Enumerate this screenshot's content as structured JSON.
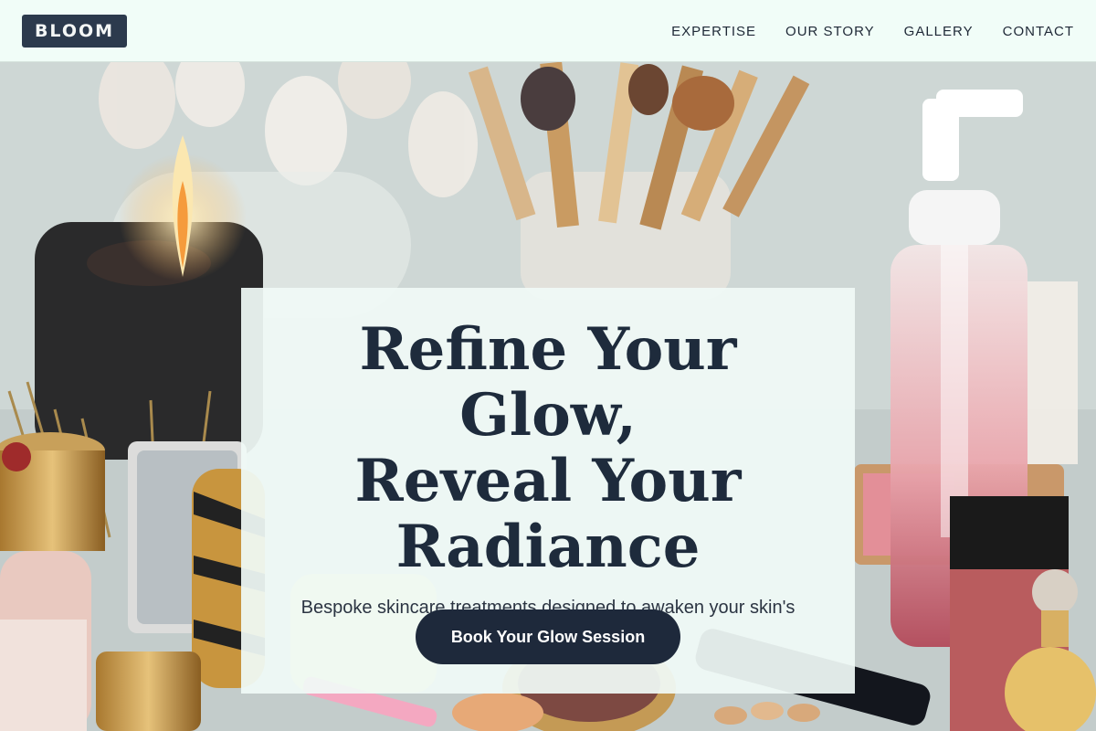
{
  "header": {
    "logo": "BLOOM",
    "nav": [
      "EXPERTISE",
      "OUR STORY",
      "GALLERY",
      "CONTACT"
    ]
  },
  "hero": {
    "headline_lines": [
      "Refine Your Glow,",
      "Reveal Your",
      "Radiance"
    ],
    "subheadline": "Bespoke skincare treatments designed to awaken your skin's natural brilliance.",
    "cta_label": "Book Your Glow Session",
    "background_image": "makeup-vanity-photo"
  },
  "colors": {
    "header_bg": "#f1fdf8",
    "logo_bg": "#2c3a4d",
    "text_dark": "#1e2b3c",
    "cta_bg": "#1e293b",
    "card_bg": "#f0faf6"
  }
}
